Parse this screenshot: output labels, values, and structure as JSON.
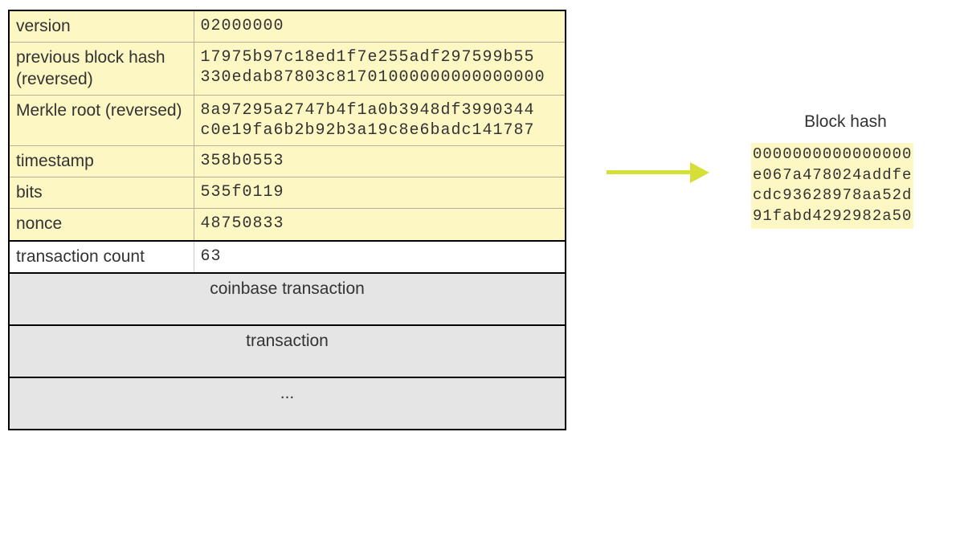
{
  "header_fields": [
    {
      "label": "version",
      "value_lines": [
        "02000000"
      ]
    },
    {
      "label": "previous block hash (reversed)",
      "value_lines": [
        "17975b97c18ed1f7e255adf297599b55",
        "330edab87803c81701000000000000000"
      ]
    },
    {
      "label": "Merkle root (reversed)",
      "value_lines": [
        "8a97295a2747b4f1a0b3948df3990344",
        "c0e19fa6b2b92b3a19c8e6badc141787"
      ]
    },
    {
      "label": "timestamp",
      "value_lines": [
        "358b0553"
      ]
    },
    {
      "label": "bits",
      "value_lines": [
        "535f0119"
      ]
    },
    {
      "label": "nonce",
      "value_lines": [
        "48750833"
      ]
    }
  ],
  "tx_count": {
    "label": "transaction count",
    "value": "63"
  },
  "tx_list": [
    "coinbase transaction",
    "transaction",
    "..."
  ],
  "hash_panel": {
    "title": "Block hash",
    "lines": [
      "0000000000000000",
      "e067a478024addfe",
      "cdc93628978aa52d",
      "91fabd4292982a50"
    ]
  }
}
